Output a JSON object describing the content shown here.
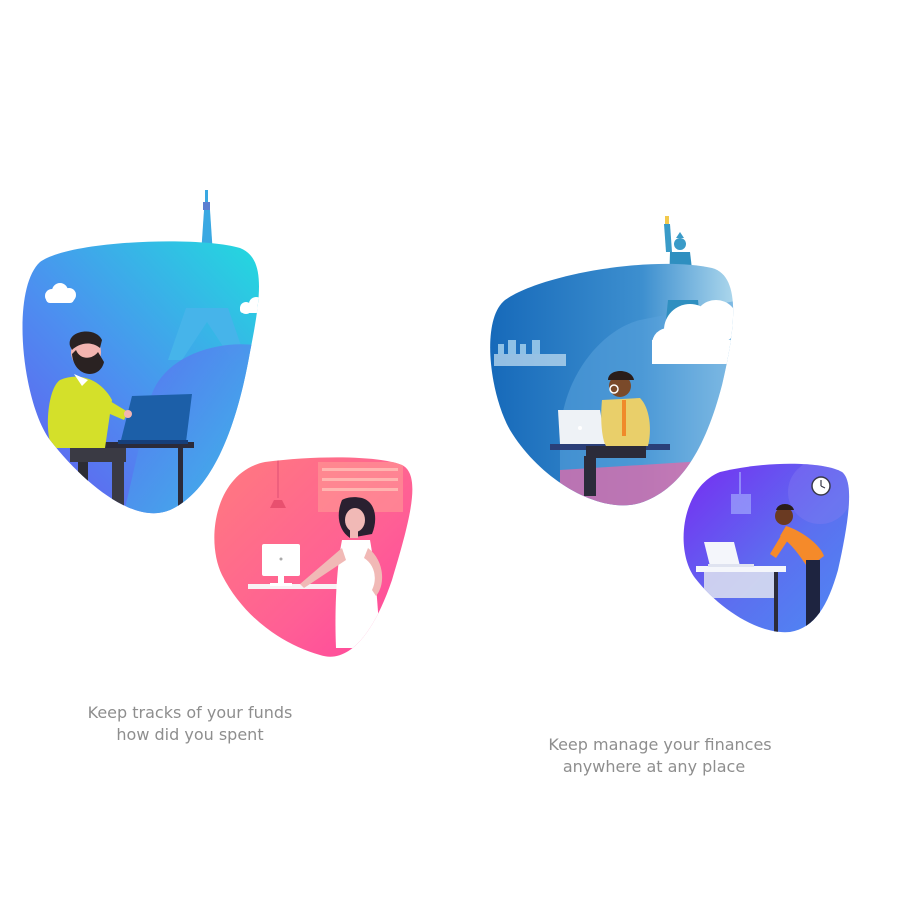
{
  "cards": [
    {
      "id": "paris",
      "illustration": "man-with-laptop-eiffel-tower",
      "line1": "Keep tracks of your funds",
      "line2": "how did you spent"
    },
    {
      "id": "new-york",
      "illustration": "man-with-laptop-statue-of-liberty",
      "line1": "Keep manage your finances",
      "line2": "anywhere at any place"
    }
  ],
  "colors": {
    "caption": "#8e8e8e",
    "blue_gradient_start": "#5c6cf0",
    "blue_gradient_end": "#1fd6de",
    "pink_gradient_start": "#ff7b8e",
    "pink_gradient_end": "#ff3f9a",
    "ocean_gradient_start": "#1565b8",
    "ocean_gradient_end": "#b6dcef",
    "violet_gradient_start": "#7b2ff7",
    "violet_gradient_end": "#4e8ef0"
  }
}
